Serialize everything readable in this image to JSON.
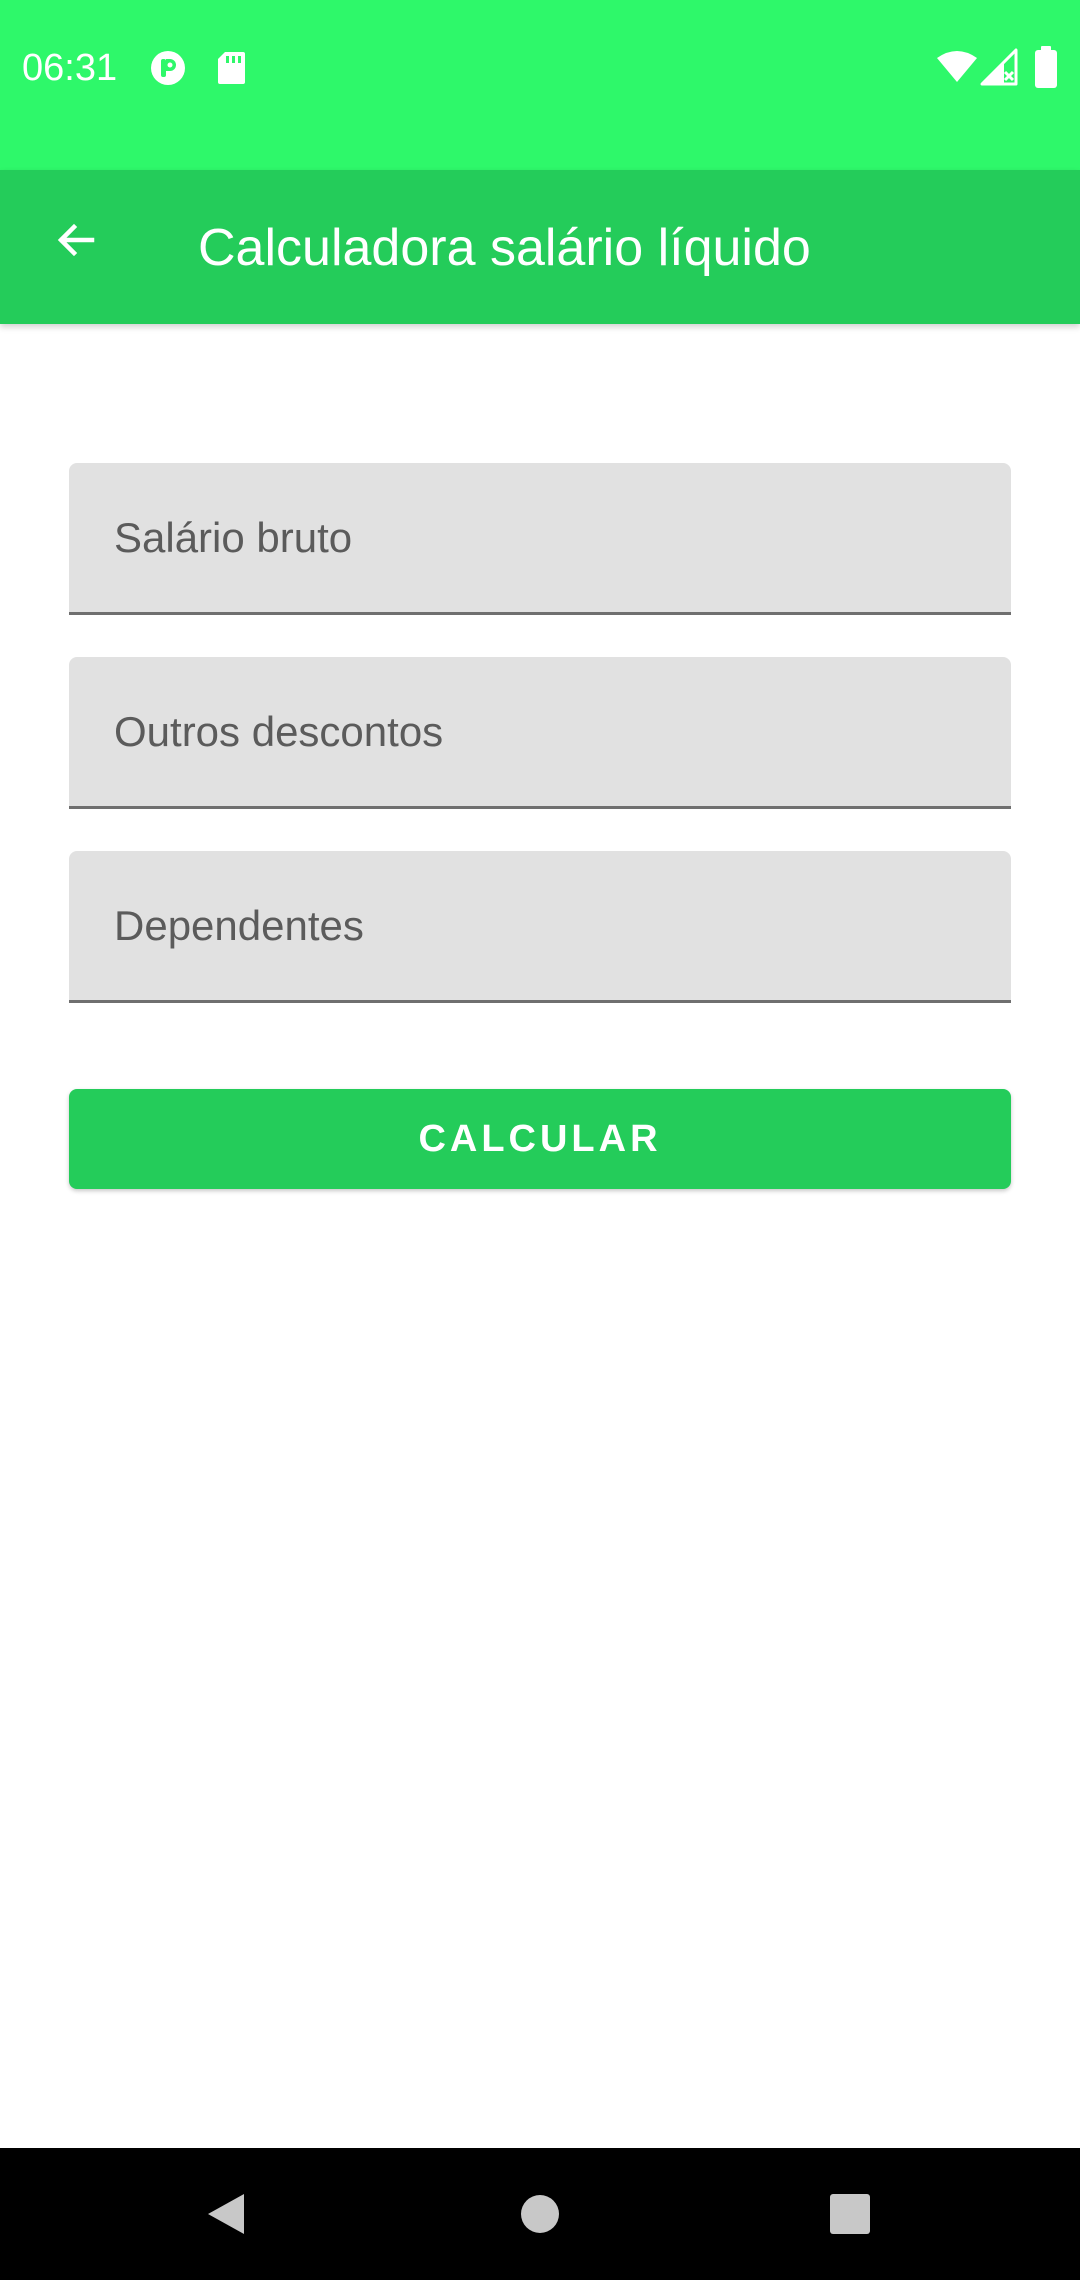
{
  "status_bar": {
    "time": "06:31",
    "icons": [
      "notification-p-icon",
      "sd-card-icon",
      "wifi-icon",
      "signal-icon",
      "battery-icon"
    ],
    "background_color": "#2ef86a"
  },
  "app_bar": {
    "title": "Calculadora salário líquido",
    "back_icon": "arrow-left-icon",
    "background_color": "#24cc5a"
  },
  "form": {
    "gross_salary": {
      "placeholder": "Salário bruto",
      "value": ""
    },
    "other_discounts": {
      "placeholder": "Outros descontos",
      "value": ""
    },
    "dependents": {
      "placeholder": "Dependentes",
      "value": ""
    },
    "calculate_label": "CALCULAR"
  },
  "nav_bar": {
    "buttons": [
      "back-triangle-icon",
      "home-circle-icon",
      "recents-square-icon"
    ]
  }
}
